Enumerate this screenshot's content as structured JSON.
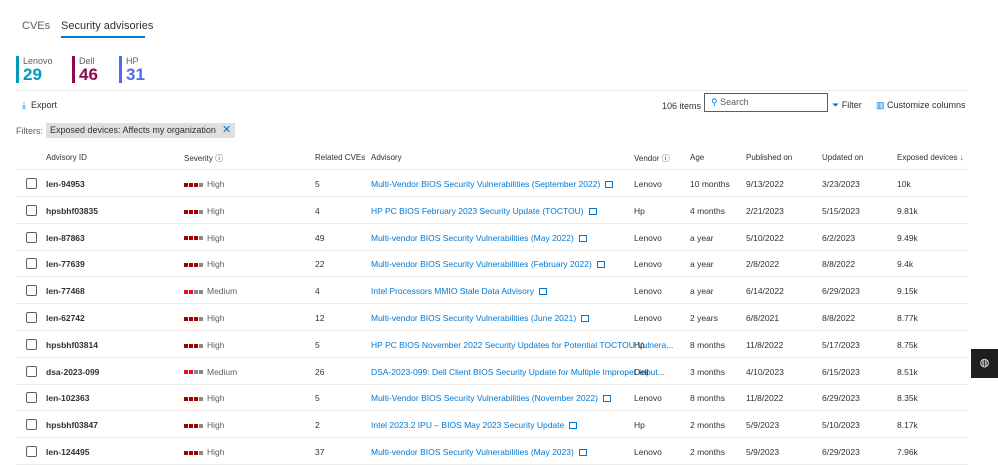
{
  "tabs": [
    {
      "label": "CVEs"
    },
    {
      "label": "Security advisories"
    }
  ],
  "vendors": [
    {
      "name": "Lenovo",
      "count": "29",
      "color": "#0099bc"
    },
    {
      "name": "Dell",
      "count": "46",
      "color": "#8b0a50"
    },
    {
      "name": "HP",
      "count": "31",
      "color": "#4f6bed"
    }
  ],
  "toolbar": {
    "export": "Export",
    "items_count": "106 items",
    "search_placeholder": "Search",
    "filter": "Filter",
    "customize": "Customize columns"
  },
  "filters": {
    "label": "Filters:",
    "chip": "Exposed devices: Affects my organization"
  },
  "columns": {
    "id": "Advisory ID",
    "severity": "Severity",
    "related": "Related CVEs",
    "advisory": "Advisory",
    "vendor": "Vendor",
    "age": "Age",
    "published": "Published on",
    "updated": "Updated on",
    "exposed": "Exposed devices"
  },
  "rows": [
    {
      "id": "len-94953",
      "severity": "High",
      "related": "5",
      "advisory": "Multi-Vendor BIOS Security Vulnerabilities (September 2022)",
      "ext": true,
      "vendor": "Lenovo",
      "age": "10 months",
      "published": "9/13/2022",
      "updated": "3/23/2023",
      "exposed": "10k"
    },
    {
      "id": "hpsbhf03835",
      "severity": "High",
      "related": "4",
      "advisory": "HP PC BIOS February 2023 Security Update (TOCTOU)",
      "ext": true,
      "vendor": "Hp",
      "age": "4 months",
      "published": "2/21/2023",
      "updated": "5/15/2023",
      "exposed": "9.81k"
    },
    {
      "id": "len-87863",
      "severity": "High",
      "related": "49",
      "advisory": "Multi-vendor BIOS Security Vulnerabilities (May 2022)",
      "ext": true,
      "vendor": "Lenovo",
      "age": "a year",
      "published": "5/10/2022",
      "updated": "6/2/2023",
      "exposed": "9.49k"
    },
    {
      "id": "len-77639",
      "severity": "High",
      "related": "22",
      "advisory": "Multi-vendor BIOS Security Vulnerabilities (February 2022)",
      "ext": true,
      "vendor": "Lenovo",
      "age": "a year",
      "published": "2/8/2022",
      "updated": "8/8/2022",
      "exposed": "9.4k"
    },
    {
      "id": "len-77468",
      "severity": "Medium",
      "related": "4",
      "advisory": "Intel Processors MMIO Stale Data Advisory",
      "ext": true,
      "vendor": "Lenovo",
      "age": "a year",
      "published": "6/14/2022",
      "updated": "6/29/2023",
      "exposed": "9.15k"
    },
    {
      "id": "len-62742",
      "severity": "High",
      "related": "12",
      "advisory": "Multi-vendor BIOS Security Vulnerabilities (June 2021)",
      "ext": true,
      "vendor": "Lenovo",
      "age": "2 years",
      "published": "6/8/2021",
      "updated": "8/8/2022",
      "exposed": "8.77k"
    },
    {
      "id": "hpsbhf03814",
      "severity": "High",
      "related": "5",
      "advisory": "HP PC BIOS November 2022 Security Updates for Potential TOCTOU Vulnera...",
      "ext": false,
      "vendor": "Hp",
      "age": "8 months",
      "published": "11/8/2022",
      "updated": "5/17/2023",
      "exposed": "8.75k"
    },
    {
      "id": "dsa-2023-099",
      "severity": "Medium",
      "related": "26",
      "advisory": "DSA-2023-099: Dell Client BIOS Security Update for Multiple Improper Input...",
      "ext": false,
      "vendor": "Dell",
      "age": "3 months",
      "published": "4/10/2023",
      "updated": "6/15/2023",
      "exposed": "8.51k"
    },
    {
      "id": "len-102363",
      "severity": "High",
      "related": "5",
      "advisory": "Multi-Vendor BIOS Security Vulnerabilities (November 2022)",
      "ext": true,
      "vendor": "Lenovo",
      "age": "8 months",
      "published": "11/8/2022",
      "updated": "6/29/2023",
      "exposed": "8.35k"
    },
    {
      "id": "hpsbhf03847",
      "severity": "High",
      "related": "2",
      "advisory": "Intel 2023.2 IPU – BIOS May 2023 Security Update",
      "ext": true,
      "vendor": "Hp",
      "age": "2 months",
      "published": "5/9/2023",
      "updated": "5/10/2023",
      "exposed": "8.17k"
    },
    {
      "id": "len-124495",
      "severity": "High",
      "related": "37",
      "advisory": "Multi-vendor BIOS Security Vulnerabilities (May 2023)",
      "ext": true,
      "vendor": "Lenovo",
      "age": "2 months",
      "published": "5/9/2023",
      "updated": "6/29/2023",
      "exposed": "7.96k"
    }
  ],
  "colors": {
    "high": "#a80000",
    "medium": "#e81123",
    "inactive": "#8a8886",
    "accent": "#0078d4"
  }
}
